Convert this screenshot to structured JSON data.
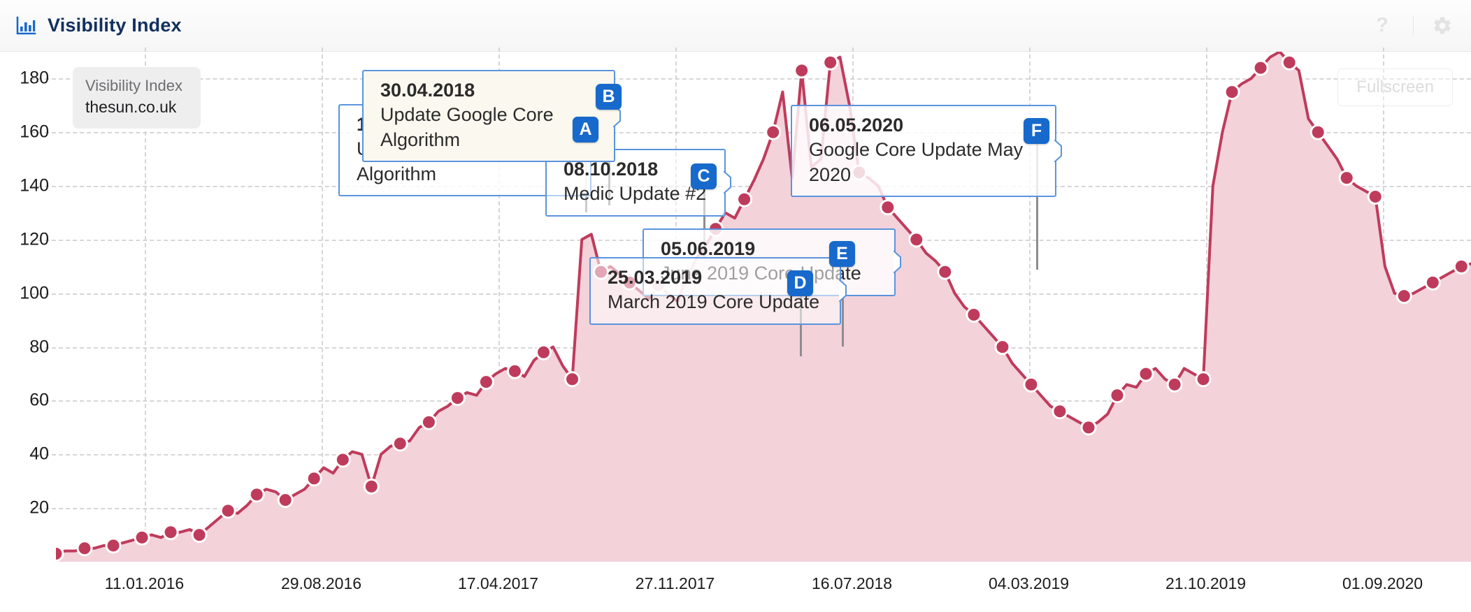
{
  "header": {
    "title": "Visibility Index",
    "icon": "bar-chart-icon",
    "help_label": "?",
    "help_icon": "question-mark-icon",
    "settings_icon": "gear-icon",
    "brand_color": "#12305e",
    "accent_color": "#1769cc"
  },
  "legend": {
    "metric_label": "Visibility Index",
    "series_label": "thesun.co.uk"
  },
  "controls": {
    "fullscreen_label": "Fullscreen"
  },
  "annotations": [
    {
      "key": "A",
      "date": "19.03.2018",
      "title": "Update Google Core Algorithm"
    },
    {
      "key": "B",
      "date": "30.04.2018",
      "title": "Update Google Core Algorithm"
    },
    {
      "key": "C",
      "date": "08.10.2018",
      "title": "Medic Update #2"
    },
    {
      "key": "D",
      "date": "25.03.2019",
      "title": "March 2019 Core Update"
    },
    {
      "key": "E",
      "date": "05.06.2019",
      "title": "June 2019 Core Update"
    },
    {
      "key": "F",
      "date": "06.05.2020",
      "title": "Google Core Update May 2020"
    }
  ],
  "chart_data": {
    "type": "area",
    "title": "Visibility Index",
    "series_name": "thesun.co.uk",
    "xlabel": "",
    "ylabel": "Visibility Index",
    "grid": true,
    "legend_position": "top-left",
    "line_color": "#bf3b5c",
    "fill_color": "#f3d2da",
    "point_color": "#bf3b5c",
    "ylim": [
      0,
      190
    ],
    "yticks": [
      20,
      40,
      60,
      80,
      100,
      120,
      140,
      160,
      180
    ],
    "xticks": [
      "11.01.2016",
      "29.08.2016",
      "17.04.2017",
      "27.11.2017",
      "16.07.2018",
      "04.03.2019",
      "21.10.2019",
      "01.09.2020"
    ],
    "x": [
      "11.01.2016",
      "29.08.2016",
      "17.04.2017",
      "27.11.2017",
      "16.07.2018",
      "04.03.2019",
      "21.10.2019",
      "01.09.2020"
    ],
    "values": [
      3,
      4,
      4,
      5,
      5,
      6,
      6,
      7,
      8,
      9,
      10,
      9,
      11,
      11,
      12,
      10,
      13,
      16,
      19,
      18,
      21,
      25,
      27,
      26,
      23,
      25,
      27,
      31,
      35,
      33,
      38,
      41,
      40,
      28,
      40,
      43,
      44,
      45,
      50,
      52,
      56,
      58,
      61,
      63,
      62,
      67,
      70,
      72,
      71,
      69,
      75,
      78,
      80,
      73,
      68,
      120,
      122,
      108,
      110,
      107,
      104,
      101,
      98,
      103,
      100,
      97,
      106,
      113,
      118,
      124,
      130,
      128,
      135,
      142,
      150,
      160,
      175,
      143,
      183,
      147,
      150,
      186,
      188,
      170,
      145,
      143,
      140,
      132,
      128,
      124,
      120,
      115,
      112,
      108,
      100,
      95,
      92,
      88,
      84,
      80,
      74,
      70,
      66,
      62,
      58,
      56,
      54,
      52,
      50,
      52,
      55,
      62,
      66,
      65,
      70,
      72,
      68,
      66,
      72,
      70,
      68,
      140,
      160,
      175,
      178,
      180,
      184,
      188,
      190,
      186,
      183,
      165,
      160,
      155,
      150,
      143,
      140,
      138,
      136,
      110,
      100,
      99,
      100,
      102,
      104,
      106,
      108,
      110,
      111
    ]
  }
}
